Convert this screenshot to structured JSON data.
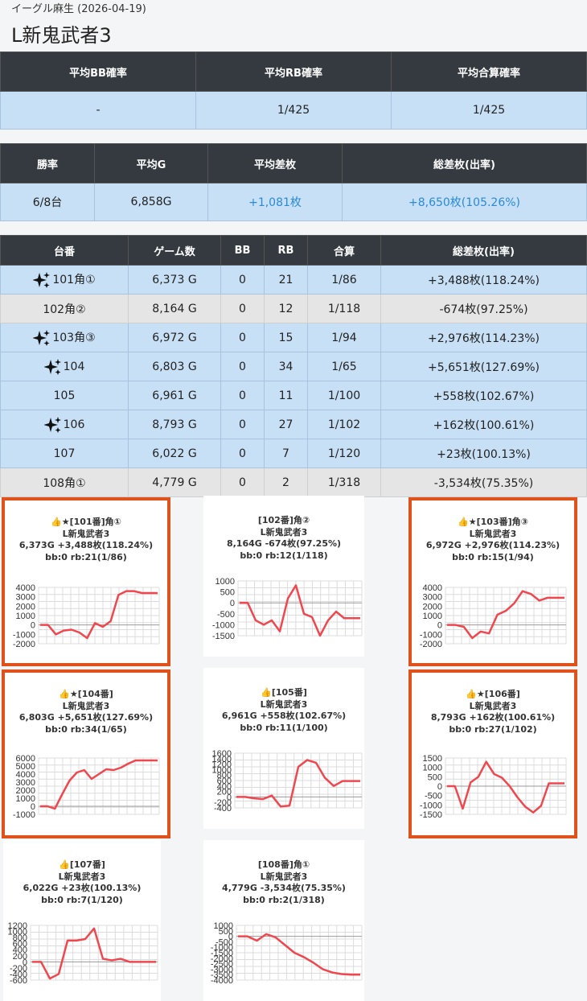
{
  "header": {
    "subtitle": "イーグル麻生 (2026-04-19)",
    "title": "L新鬼武者3"
  },
  "summary1": {
    "headers": [
      "平均BB確率",
      "平均RB確率",
      "平均合算確率"
    ],
    "values": [
      "-",
      "1/425",
      "1/425"
    ]
  },
  "summary2": {
    "headers": [
      "勝率",
      "平均G",
      "平均差枚",
      "総差枚(出率)"
    ],
    "values": [
      "6/8台",
      "6,858G",
      "+1,081枚",
      "+8,650枚(105.26%)"
    ]
  },
  "machines": {
    "headers": [
      "台番",
      "ゲーム数",
      "BB",
      "RB",
      "合算",
      "総差枚(出率)"
    ],
    "rows": [
      {
        "name": "101角①",
        "games": "6,373 G",
        "bb": "0",
        "rb": "21",
        "total": "1/86",
        "diff": "+3,488枚(118.24%)"
      },
      {
        "name": "102角②",
        "games": "8,164 G",
        "bb": "0",
        "rb": "12",
        "total": "1/118",
        "diff": "-674枚(97.25%)"
      },
      {
        "name": "103角③",
        "games": "6,972 G",
        "bb": "0",
        "rb": "15",
        "total": "1/94",
        "diff": "+2,976枚(114.23%)"
      },
      {
        "name": "104",
        "games": "6,803 G",
        "bb": "0",
        "rb": "34",
        "total": "1/65",
        "diff": "+5,651枚(127.69%)"
      },
      {
        "name": "105",
        "games": "6,961 G",
        "bb": "0",
        "rb": "11",
        "total": "1/100",
        "diff": "+558枚(102.67%)"
      },
      {
        "name": "106",
        "games": "8,793 G",
        "bb": "0",
        "rb": "27",
        "total": "1/102",
        "diff": "+162枚(100.61%)"
      },
      {
        "name": "107",
        "games": "6,022 G",
        "bb": "0",
        "rb": "7",
        "total": "1/120",
        "diff": "+23枚(100.13%)"
      },
      {
        "name": "108角①",
        "games": "4,779 G",
        "bb": "0",
        "rb": "2",
        "total": "1/318",
        "diff": "-3,534枚(75.35%)"
      }
    ]
  },
  "charts": [
    {
      "lines": [
        "👍★[101番]角①",
        "L新鬼武者3",
        "6,373G +3,488枚(118.24%)",
        "bb:0 rb:21(1/86)"
      ],
      "chart_data": {
        "type": "line",
        "yticks": [
          "4000",
          "3000",
          "2000",
          "1000",
          "0",
          "-1000",
          "-2000"
        ],
        "ylim": [
          -2000,
          4000
        ],
        "values": [
          0,
          0,
          -1000,
          -600,
          -500,
          -800,
          -1400,
          200,
          -200,
          400,
          3200,
          3600,
          3600,
          3400,
          3400,
          3400
        ]
      }
    },
    {
      "lines": [
        "[102番]角②",
        "L新鬼武者3",
        "8,164G -674枚(97.25%)",
        "bb:0 rb:12(1/118)"
      ],
      "chart_data": {
        "type": "line",
        "yticks": [
          "1000",
          "500",
          "0",
          "-500",
          "-1000",
          "-1500"
        ],
        "ylim": [
          -1500,
          1000
        ],
        "values": [
          0,
          0,
          -800,
          -1000,
          -800,
          -1300,
          200,
          800,
          -500,
          -650,
          -1500,
          -800,
          -400,
          -700,
          -700,
          -700
        ]
      }
    },
    {
      "lines": [
        "👍★[103番]角③",
        "L新鬼武者3",
        "6,972G +2,976枚(114.23%)",
        "bb:0 rb:15(1/94)"
      ],
      "chart_data": {
        "type": "line",
        "yticks": [
          "4000",
          "3000",
          "2000",
          "1000",
          "0",
          "-1000",
          "-2000"
        ],
        "ylim": [
          -2000,
          4000
        ],
        "values": [
          0,
          0,
          -200,
          -1400,
          -700,
          -900,
          1100,
          1500,
          2300,
          3600,
          3300,
          2600,
          2900,
          2900,
          2900
        ]
      }
    },
    {
      "lines": [
        "👍★[104番]",
        "L新鬼武者3",
        "6,803G +5,651枚(127.69%)",
        "bb:0 rb:34(1/65)"
      ],
      "chart_data": {
        "type": "line",
        "yticks": [
          "6000",
          "5000",
          "4000",
          "3000",
          "2000",
          "1000",
          "0",
          "-1000"
        ],
        "ylim": [
          -1000,
          6000
        ],
        "values": [
          0,
          0,
          -300,
          1500,
          3200,
          4200,
          4500,
          3400,
          4000,
          4600,
          4500,
          4800,
          5300,
          5700,
          5700,
          5700,
          5700
        ]
      }
    },
    {
      "lines": [
        "👍[105番]",
        "L新鬼武者3",
        "6,961G +558枚(102.67%)",
        "bb:0 rb:11(1/100)"
      ],
      "chart_data": {
        "type": "line",
        "yticks": [
          "1600",
          "1400",
          "1200",
          "1000",
          "800",
          "600",
          "400",
          "200",
          "0",
          "-200",
          "-400"
        ],
        "ylim": [
          -400,
          1600
        ],
        "values": [
          0,
          0,
          -50,
          -80,
          50,
          -350,
          -320,
          1100,
          1350,
          1250,
          700,
          400,
          580,
          580,
          580
        ]
      }
    },
    {
      "lines": [
        "👍★[106番]",
        "L新鬼武者3",
        "8,793G +162枚(100.61%)",
        "bb:0 rb:27(1/102)"
      ],
      "chart_data": {
        "type": "line",
        "yticks": [
          "1500",
          "1000",
          "500",
          "0",
          "-500",
          "-1000",
          "-1500"
        ],
        "ylim": [
          -1500,
          1500
        ],
        "values": [
          0,
          0,
          -1200,
          200,
          500,
          1300,
          650,
          450,
          0,
          -600,
          -1100,
          -1400,
          -1050,
          150,
          150,
          150
        ]
      }
    },
    {
      "lines": [
        "👍[107番]",
        "L新鬼武者3",
        "6,022G +23枚(100.13%)",
        "bb:0 rb:7(1/120)"
      ],
      "chart_data": {
        "type": "line",
        "yticks": [
          "1200",
          "1000",
          "800",
          "600",
          "400",
          "200",
          "0",
          "-200",
          "-400",
          "-600"
        ],
        "ylim": [
          -600,
          1200
        ],
        "values": [
          0,
          0,
          -550,
          -400,
          700,
          700,
          750,
          1100,
          100,
          50,
          100,
          0,
          0,
          0,
          0
        ]
      }
    },
    {
      "lines": [
        "[108番]角①",
        "L新鬼武者3",
        "4,779G -3,534枚(75.35%)",
        "bb:0 rb:2(1/318)"
      ],
      "chart_data": {
        "type": "line",
        "yticks": [
          "1000",
          "500",
          "0",
          "-500",
          "-1000",
          "-1500",
          "-2000",
          "-2500",
          "-3000",
          "-3500",
          "-4000"
        ],
        "ylim": [
          -4000,
          1000
        ],
        "values": [
          0,
          0,
          -400,
          200,
          -100,
          -800,
          -1500,
          -1900,
          -2400,
          -3000,
          -3300,
          -3450,
          -3500,
          -3500
        ]
      }
    }
  ]
}
